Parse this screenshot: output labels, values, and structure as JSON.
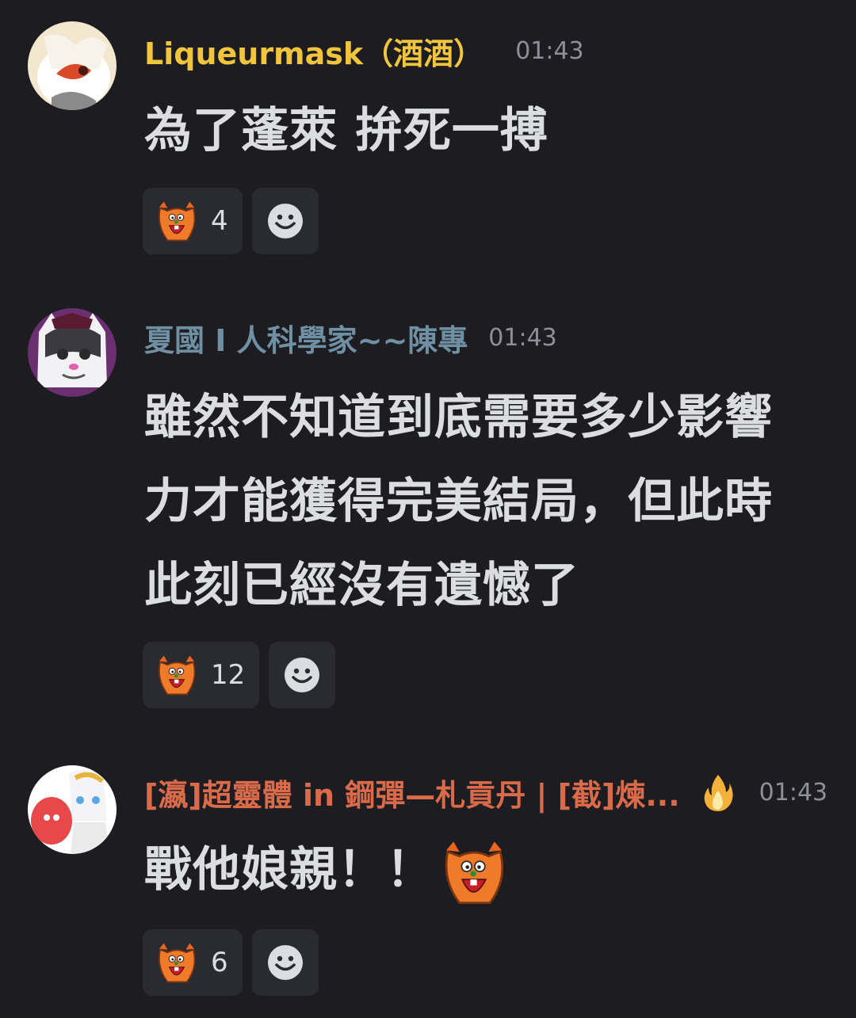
{
  "messages": [
    {
      "username": "Liqueurmask（酒酒）",
      "username_color": "#f0c43b",
      "timestamp": "01:43",
      "lines": [
        "為了蓬萊 拚死一搏"
      ],
      "reaction": {
        "emoji": "orange-squirrel-emoji",
        "count": "4"
      }
    },
    {
      "username": "夏國 I 人科學家~~陳專",
      "username_color": "#6f8fa3",
      "timestamp": "01:43",
      "lines": [
        "雖然不知道到底需要多少影響",
        "力才能獲得完美結局，但此時",
        "此刻已經沒有遺憾了"
      ],
      "reaction": {
        "emoji": "orange-squirrel-emoji",
        "count": "12"
      }
    },
    {
      "username": "[瀛]超靈體 in 鋼彈—札貢丹 | [截]煉...",
      "username_color": "#d96a4a",
      "timestamp": "01:43",
      "badge": "fire-icon",
      "lines": [
        "戰他娘親！！"
      ],
      "inline_emoji": "orange-squirrel-emoji",
      "reaction": {
        "emoji": "orange-squirrel-emoji",
        "count": "6"
      }
    }
  ],
  "add_reaction_icon": "smiley-face-icon",
  "colors": {
    "background": "#1c1c21",
    "reaction_bg": "#2a2b31",
    "message_text": "#dcdde1",
    "timestamp": "#8e9099"
  }
}
